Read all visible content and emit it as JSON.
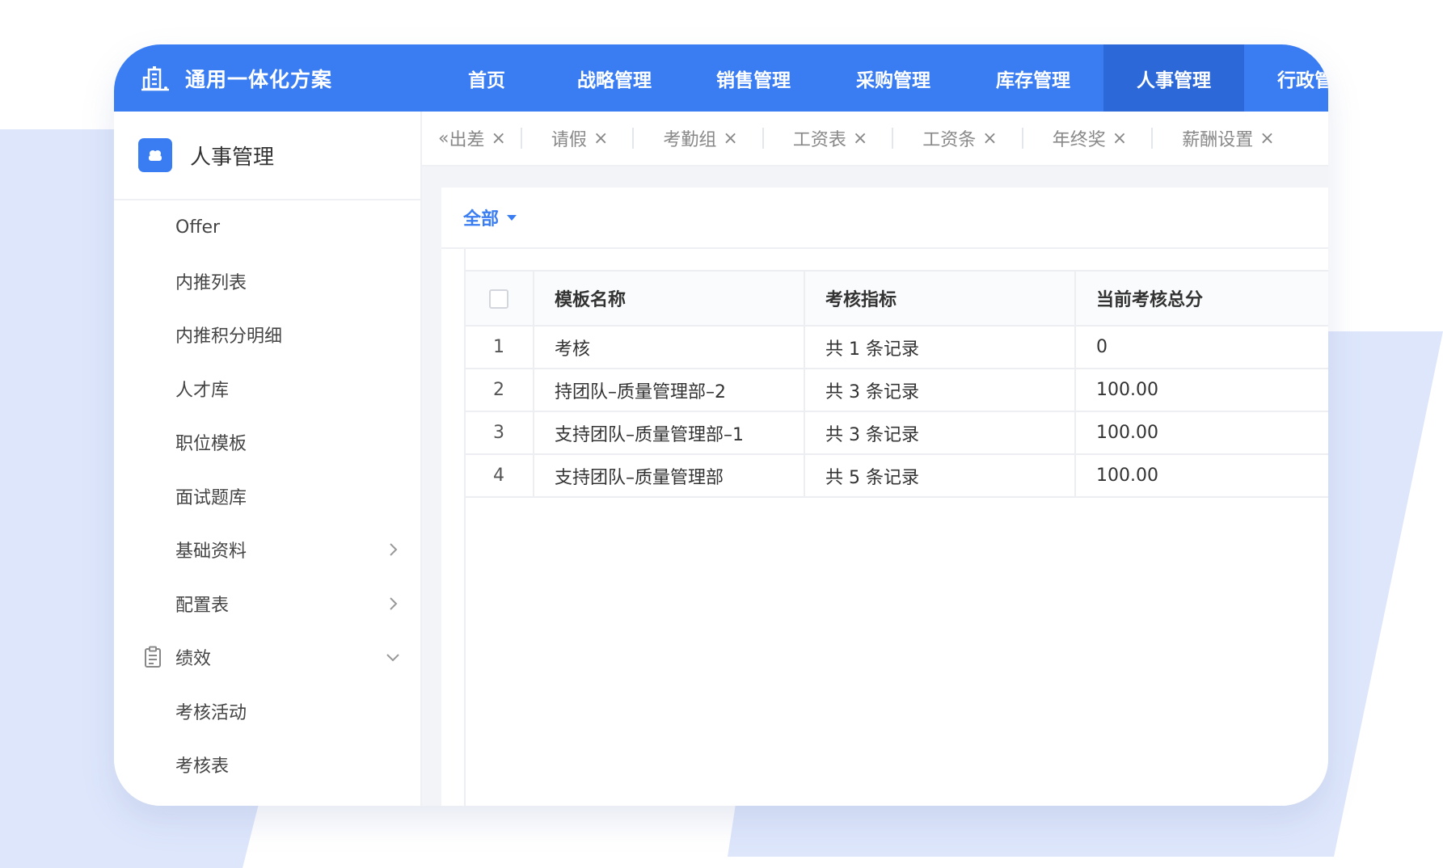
{
  "app": {
    "title": "通用一体化方案",
    "brand_icon": "building-icon"
  },
  "nav": {
    "items": [
      {
        "label": "首页",
        "active": false
      },
      {
        "label": "战略管理",
        "active": false
      },
      {
        "label": "销售管理",
        "active": false
      },
      {
        "label": "采购管理",
        "active": false
      },
      {
        "label": "库存管理",
        "active": false
      },
      {
        "label": "人事管理",
        "active": true
      },
      {
        "label": "行政管理",
        "active": false
      }
    ]
  },
  "sidebar": {
    "title": "人事管理",
    "items": [
      {
        "label": "Offer"
      },
      {
        "label": "内推列表"
      },
      {
        "label": "内推积分明细"
      },
      {
        "label": "人才库"
      },
      {
        "label": "职位模板"
      },
      {
        "label": "面试题库"
      },
      {
        "label": "基础资料",
        "icon": "chevron-right-icon"
      },
      {
        "label": "配置表",
        "icon": "chevron-right-icon"
      },
      {
        "label": "绩效",
        "icon": "chevron-down-icon",
        "lead_icon": "clipboard-icon"
      },
      {
        "label": "考核活动"
      },
      {
        "label": "考核表"
      }
    ]
  },
  "tabs": {
    "scroll_left": "«",
    "items": [
      {
        "label": "出差"
      },
      {
        "label": "请假"
      },
      {
        "label": "考勤组"
      },
      {
        "label": "工资表"
      },
      {
        "label": "工资条"
      },
      {
        "label": "年终奖"
      },
      {
        "label": "薪酬设置"
      }
    ],
    "close_glyph": "×"
  },
  "filter": {
    "label": "全部"
  },
  "table": {
    "columns": [
      "模板名称",
      "考核指标",
      "当前考核总分"
    ],
    "rows": [
      {
        "index": "1",
        "name": "考核",
        "metric": "共 1 条记录",
        "score": "0"
      },
      {
        "index": "2",
        "name": "持团队–质量管理部–2",
        "metric": "共 3 条记录",
        "score": "100.00"
      },
      {
        "index": "3",
        "name": "支持团队–质量管理部–1",
        "metric": "共 3 条记录",
        "score": "100.00"
      },
      {
        "index": "4",
        "name": "支持团队–质量管理部",
        "metric": "共 5 条记录",
        "score": "100.00"
      }
    ]
  },
  "colors": {
    "primary": "#3a7df3",
    "nav_active": "#2c68d7",
    "background_shape": "#dde6fb"
  }
}
